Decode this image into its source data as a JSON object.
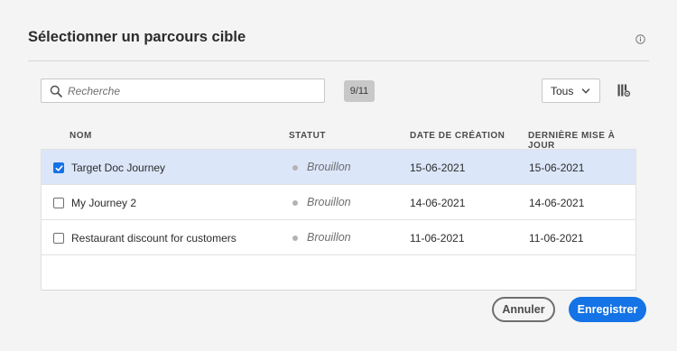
{
  "dialog": {
    "title": "Sélectionner un parcours cible"
  },
  "search": {
    "placeholder": "Recherche",
    "value": ""
  },
  "count_badge": "9/11",
  "filter": {
    "selected": "Tous"
  },
  "table": {
    "headers": {
      "name": "NOM",
      "status": "STATUT",
      "created": "DATE DE CRÉATION",
      "updated": "DERNIÈRE MISE À JOUR"
    },
    "rows": [
      {
        "name": "Target Doc Journey",
        "status": "Brouillon",
        "created": "15-06-2021",
        "updated": "15-06-2021",
        "checked": true
      },
      {
        "name": "My Journey 2",
        "status": "Brouillon",
        "created": "14-06-2021",
        "updated": "14-06-2021",
        "checked": false
      },
      {
        "name": "Restaurant discount for customers",
        "status": "Brouillon",
        "created": "11-06-2021",
        "updated": "11-06-2021",
        "checked": false
      }
    ]
  },
  "actions": {
    "cancel_label": "Annuler",
    "save_label": "Enregistrer"
  },
  "colors": {
    "accent": "#1473e6",
    "selected_row": "#dbe6f9",
    "background": "#f4f4f4"
  },
  "icons": {
    "info": "info-icon",
    "search": "search-icon",
    "chevron": "chevron-down-icon",
    "columns": "column-settings-icon",
    "checkmark": "checkmark-icon"
  }
}
